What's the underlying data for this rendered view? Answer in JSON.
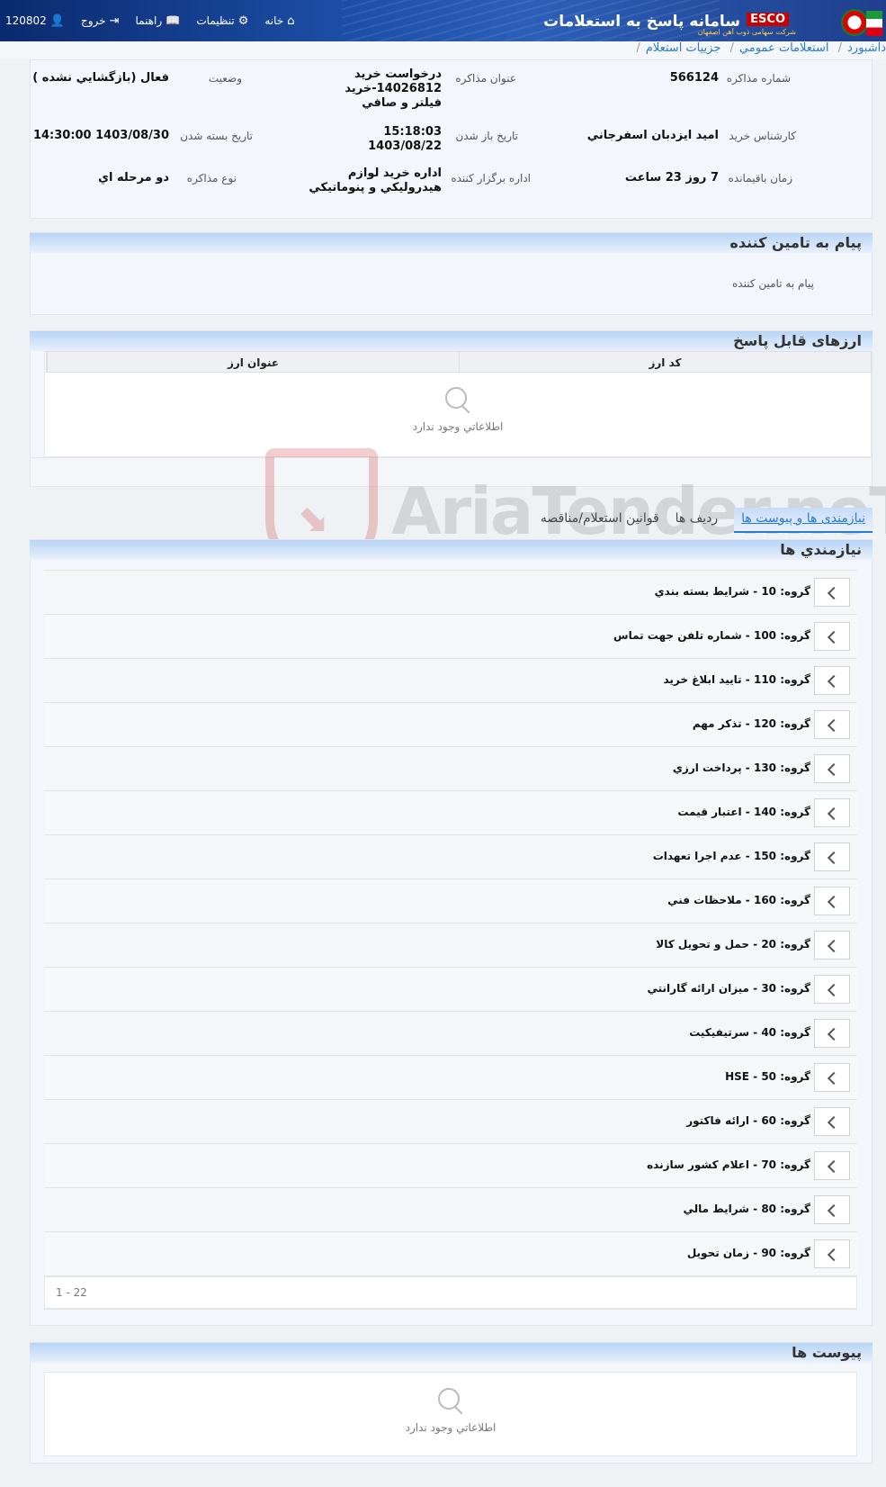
{
  "header": {
    "app_title": "سامانه پاسخ به استعلامات",
    "brand": "ESCO",
    "brand_sub": "شرکت سهامی ذوب آهن اصفهان",
    "nav": {
      "home": "خانه",
      "settings": "تنظیمات",
      "help": "راهنما",
      "logout": "خروج",
      "user": "120802"
    }
  },
  "breadcrumb": [
    "داشبورد",
    "استعلامات عمومي",
    "جزييات استعلام"
  ],
  "info": {
    "negotiation_no_label": "شماره مذاکره",
    "negotiation_no": "566124",
    "title_label": "عنوان مذاکره",
    "title": "درخواست خريد 14026812-خريد فيلتر و صافي",
    "status_label": "وضعيت",
    "status": "فعال (بازگشايي نشده )",
    "buyer_label": "کارشناس خريد",
    "buyer": "اميد ايزدبان اسفرجاني",
    "open_date_label": "تاريخ باز شدن",
    "open_time": "15:18:03",
    "open_date": "1403/08/22",
    "close_date_label": "تاريخ بسته شدن",
    "close_date": "1403/08/30 14:30:00",
    "remaining_label": "زمان باقيمانده",
    "remaining": "7 روز 23 ساعت",
    "dept_label": "اداره برگزار کننده",
    "dept": "اداره خريد لوازم هيدروليکي و پنوماتيکي",
    "type_label": "نوع مذاکره",
    "type": "دو مرحله اي"
  },
  "supplier_message": {
    "title": "پيام به تامين کننده",
    "body": "پيام به تامين کننده"
  },
  "currencies": {
    "title": "ارزهای قابل پاسخ",
    "columns": [
      "کد ارز",
      "عنوان ارز"
    ],
    "empty": "اطلاعاتي وجود ندارد"
  },
  "tabs": [
    "نیازمندی ها و پیوست ها",
    "رديف ها",
    "قوانين استعلام/مناقصه"
  ],
  "requirements": {
    "title": "نيازمندي ها",
    "groups": [
      "گروه: 10 - شرايط بسته بندي",
      "گروه: 100 - شماره تلفن جهت تماس",
      "گروه: 110 - تاييد ابلاغ خريد",
      "گروه: 120 - تذکر مهم",
      "گروه: 130 - پرداخت ارزي",
      "گروه: 140 - اعتبار قيمت",
      "گروه: 150 - عدم اجرا تعهدات",
      "گروه: 160 - ملاحظات فني",
      "گروه: 20 - حمل و تحويل کالا",
      "گروه: 30 - ميزان ارائه گارانتي",
      "گروه: 40 - سرتيفيکيت",
      "گروه: 50 - HSE",
      "گروه: 60 - ارائه فاکتور",
      "گروه: 70 - اعلام کشور سازنده",
      "گروه: 80 - شرايط مالي",
      "گروه: 90 - زمان تحويل"
    ],
    "pager": "1 - 22"
  },
  "attachments": {
    "title": "پیوست ها",
    "empty": "اطلاعاتي وجود ندارد"
  },
  "watermark": "AriaTender.neT"
}
